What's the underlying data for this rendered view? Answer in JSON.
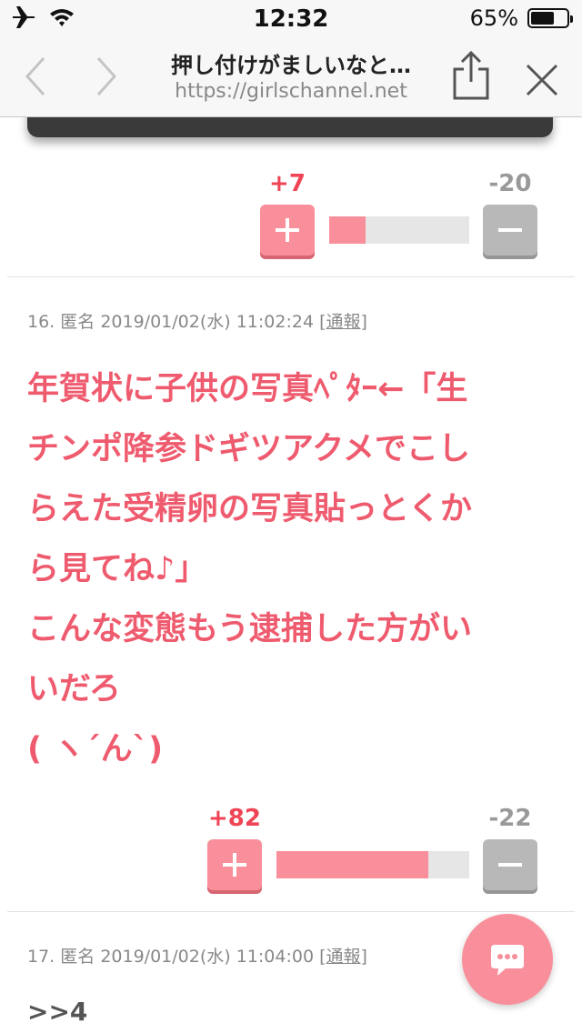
{
  "status_bar": {
    "time": "12:32",
    "battery": "65%",
    "battery_level": 0.65
  },
  "browser": {
    "title": "押し付けがましいなと…",
    "url": "https://girlschannel.net"
  },
  "comments": [
    {
      "votes": {
        "plus": "+7",
        "minus": "-20",
        "ratio": 0.26
      }
    },
    {
      "number": "16.",
      "author": "匿名",
      "date": "2019/01/02(水) 11:02:24",
      "report_label": "[通報]",
      "lines": [
        "年賀状に子供の写真ﾍﾟﾀｰ←「生",
        "チンポ降参ドギツアクメでこし",
        "らえた受精卵の写真貼っとくか",
        "ら見てね♪」",
        "こんな変態もう逮捕した方がい",
        "いだろ",
        "( ヽ´ん`)"
      ],
      "votes": {
        "plus": "+82",
        "minus": "-22",
        "ratio": 0.79
      }
    },
    {
      "number": "17.",
      "author": "匿名",
      "date": "2019/01/02(水) 11:04:00",
      "report_label": "[通報]",
      "anchor": ">>4"
    }
  ]
}
